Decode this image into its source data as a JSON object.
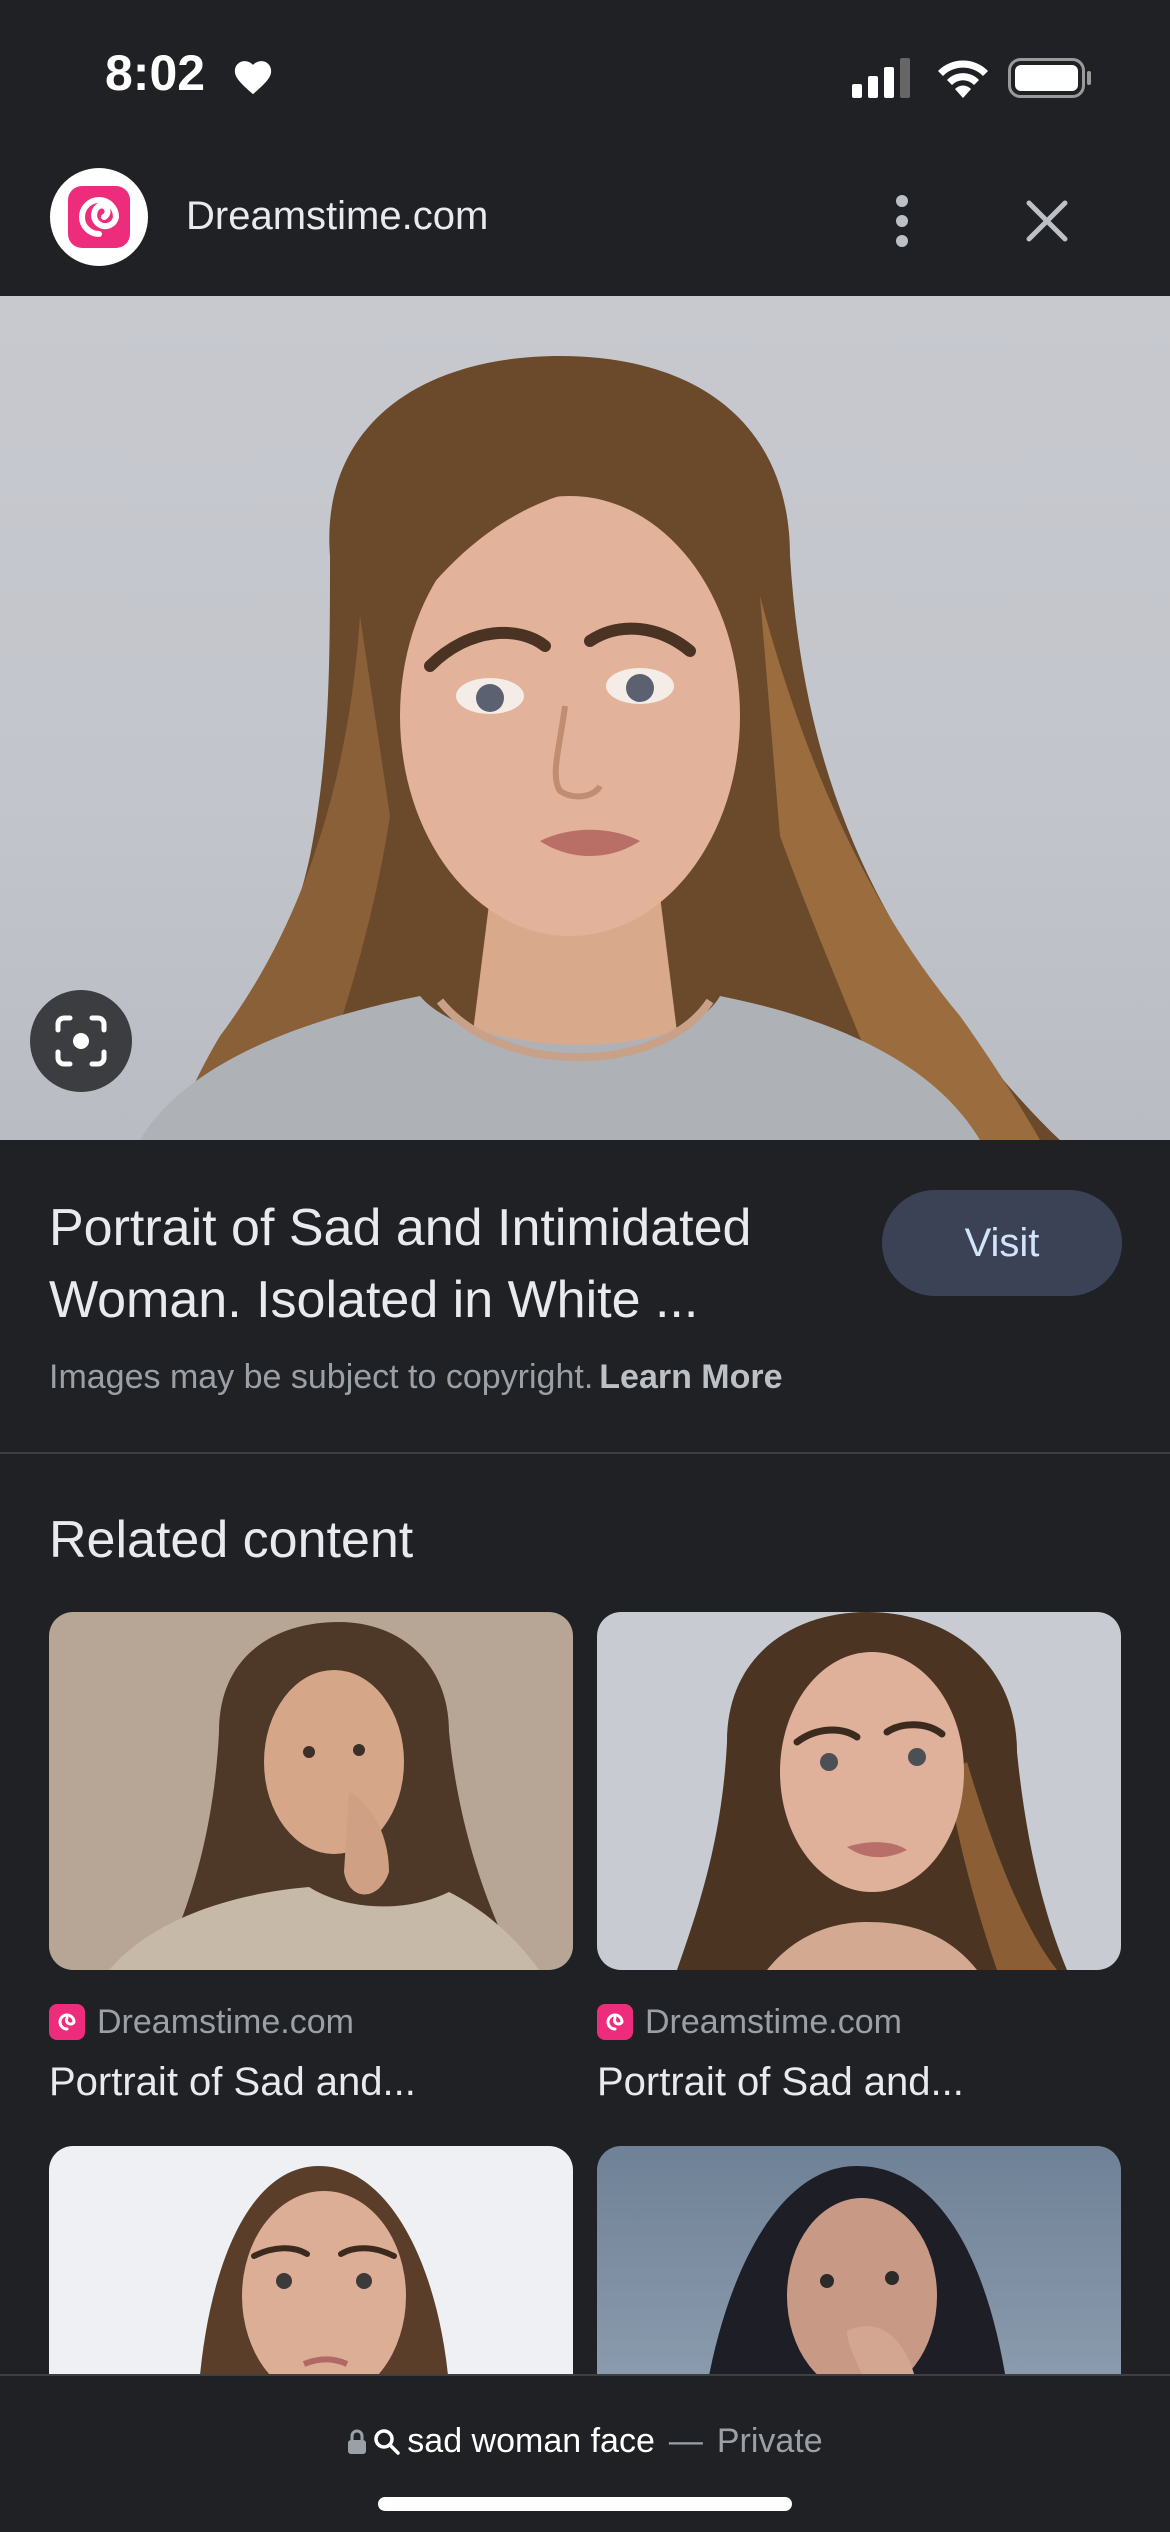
{
  "status_bar": {
    "time": "8:02",
    "icons": [
      "heart-icon",
      "signal-icon",
      "wifi-icon",
      "battery-icon"
    ]
  },
  "header": {
    "site_name": "Dreamstime.com",
    "more_icon": "more-vert-icon",
    "close_icon": "close-icon"
  },
  "image": {
    "lens_icon": "lens-icon"
  },
  "info": {
    "title": "Portrait of Sad and Intimidated Woman. Isolated in White ...",
    "visit_label": "Visit",
    "copyright_text": "Images may be subject to copyright.",
    "learn_more_label": "Learn More"
  },
  "related": {
    "heading": "Related content",
    "cards": [
      {
        "source": "Dreamstime.com",
        "title": "Portrait of Sad and..."
      },
      {
        "source": "Dreamstime.com",
        "title": "Portrait of Sad and..."
      },
      {
        "source": "",
        "title": ""
      },
      {
        "source": "",
        "title": ""
      }
    ]
  },
  "bottom_bar": {
    "query": "sad woman face",
    "separator": "—",
    "mode": "Private"
  },
  "colors": {
    "background": "#202124",
    "visit_button": "#3c4256",
    "brand_pink": "#ee2c7c"
  }
}
